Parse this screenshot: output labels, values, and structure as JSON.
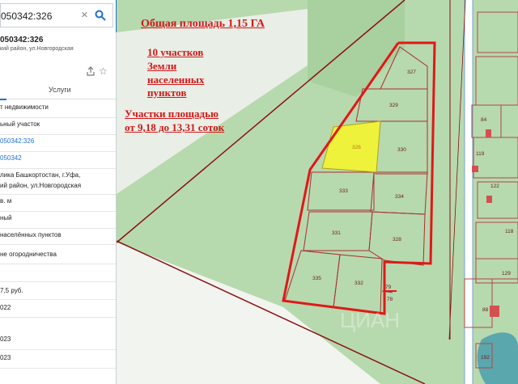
{
  "search": {
    "value": "050342:326"
  },
  "parcel": {
    "title": "050342:326",
    "subtitle": "кий район, ул.Новгородская"
  },
  "tabs": {
    "services": "Услуги"
  },
  "info_rows": [
    {
      "text": "т недвижимости",
      "link": false
    },
    {
      "text": "ьный участок",
      "link": false
    },
    {
      "text": "050342:326",
      "link": true
    },
    {
      "text": "050342",
      "link": true
    },
    {
      "text": "лика Башкортостан, г.Уфа,",
      "link": false
    },
    {
      "text": "ий район, ул.Новгородская",
      "link": false
    },
    {
      "text": "в. м",
      "link": false
    },
    {
      "text": "ный",
      "link": false
    },
    {
      "text": "населённых пунктов",
      "link": false
    },
    {
      "text": "не огородничества",
      "link": false
    },
    {
      "text": "7,5 руб.",
      "link": false
    },
    {
      "text": "022",
      "link": false
    },
    {
      "text": "023",
      "link": false
    },
    {
      "text": "023",
      "link": false
    }
  ],
  "annotations": {
    "area": "Общая площадь 1,15 ГА",
    "count_line1": "10 участков",
    "count_line2": "Земли",
    "count_line3": "населенных",
    "count_line4": "пунктов",
    "size_line1": "Участки площадью",
    "size_line2": "от 9,18  до 13,31 соток"
  },
  "plots": [
    "327",
    "329",
    "326",
    "330",
    "333",
    "334",
    "331",
    "328",
    "335",
    "332",
    "79",
    "78"
  ],
  "east_labels": [
    "84",
    "119",
    "122",
    "118",
    "129",
    "88",
    "192"
  ],
  "colors": {
    "boundary": "#e01818",
    "selected_plot": "#eef23a",
    "map_green": "#b7d9ae",
    "road": "#ffffff",
    "panel_accent": "#1e6fd0"
  }
}
